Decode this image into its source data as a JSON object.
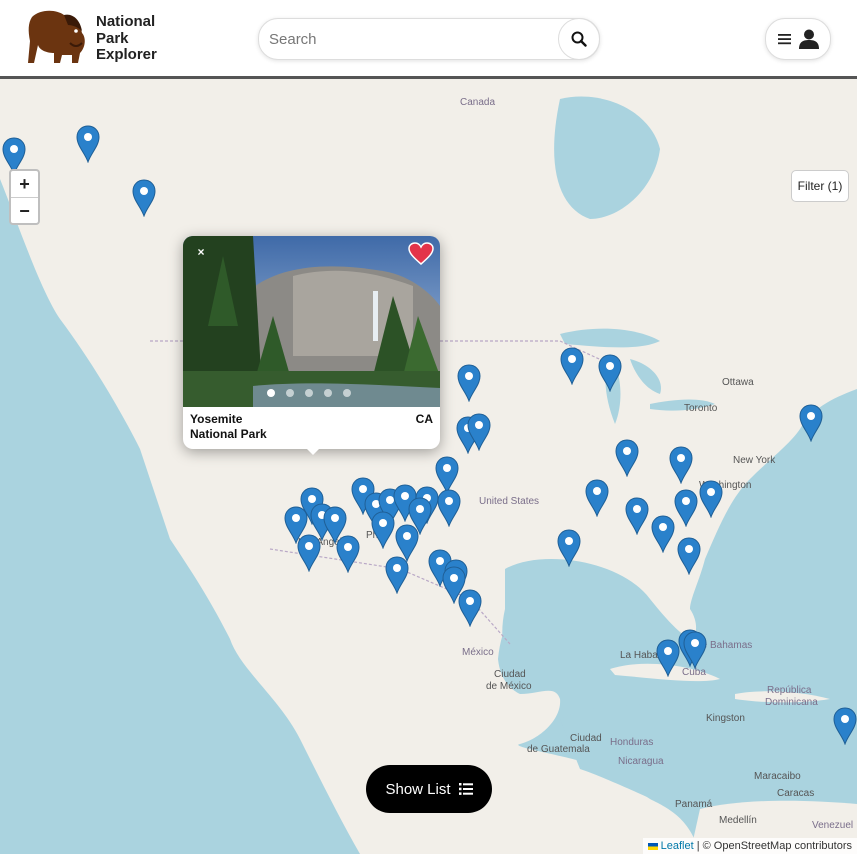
{
  "header": {
    "logo_line1": "National",
    "logo_line2": "Park",
    "logo_line3": "Explorer",
    "search_placeholder": "Search"
  },
  "map": {
    "filter_label": "Filter (1)",
    "zoom_in": "+",
    "zoom_out": "−",
    "labels": [
      {
        "text": "Canada"
      },
      {
        "text": "Ottawa"
      },
      {
        "text": "Toronto"
      },
      {
        "text": "New York"
      },
      {
        "text": "Washington"
      },
      {
        "text": "United States"
      },
      {
        "text": "Los Angeles"
      },
      {
        "text": "Phoe"
      },
      {
        "text": "México"
      },
      {
        "text": "Ciudad"
      },
      {
        "text": "de México"
      },
      {
        "text": "La Habana"
      },
      {
        "text": "The Bahamas"
      },
      {
        "text": "Cuba"
      },
      {
        "text": "República"
      },
      {
        "text": "Dominicana"
      },
      {
        "text": "Kingston"
      },
      {
        "text": "Ciudad"
      },
      {
        "text": "de Guatemala"
      },
      {
        "text": "Honduras"
      },
      {
        "text": "Nicaragua"
      },
      {
        "text": "Maracaibo"
      },
      {
        "text": "Caracas"
      },
      {
        "text": "Panamá"
      },
      {
        "text": "Medellín"
      },
      {
        "text": "Venezuel"
      }
    ]
  },
  "popup": {
    "name_line1": "Yosemite",
    "name_line2": "National Park",
    "state": "CA",
    "close": "×",
    "favorited": true,
    "slide_count": 5,
    "active_slide": 1
  },
  "show_list_label": "Show List",
  "attribution": {
    "leaflet": "Leaflet",
    "rest": " | © OpenStreetMap contributors"
  },
  "colors": {
    "marker": "#2a81cb",
    "heart": "#e3344a",
    "water": "#aad3df",
    "land": "#f2efe9"
  }
}
